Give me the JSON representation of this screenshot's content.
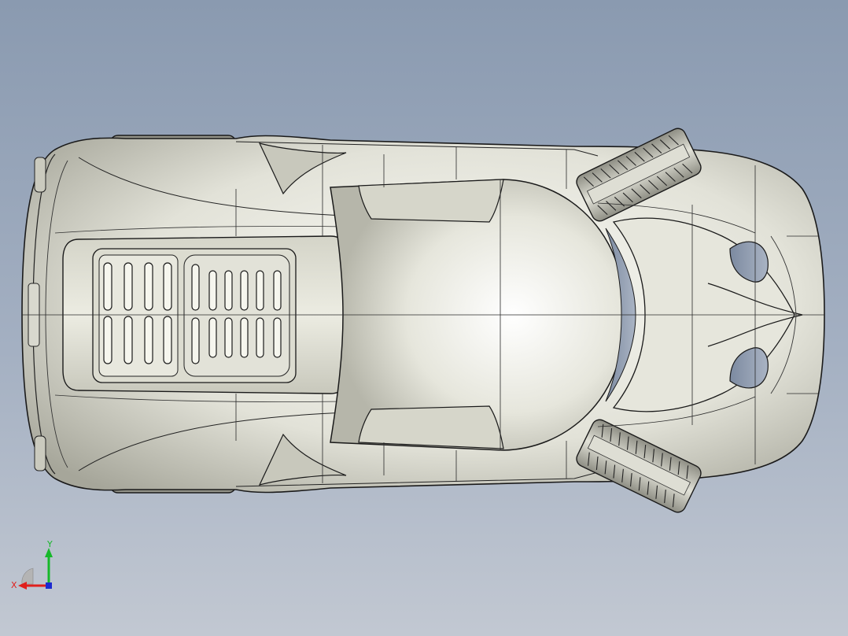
{
  "viewport": {
    "background_top": "#8a9ab0",
    "background_bottom": "#c2c8d2"
  },
  "model": {
    "body_color": "#e4e4da",
    "edge_color": "#1a1a1a",
    "tire_color": "#b8b8ad"
  },
  "triad": {
    "x_label": "X",
    "y_label": "Y",
    "x_color": "#e0201c",
    "y_color": "#16b82a",
    "z_color": "#1c2ad0"
  }
}
